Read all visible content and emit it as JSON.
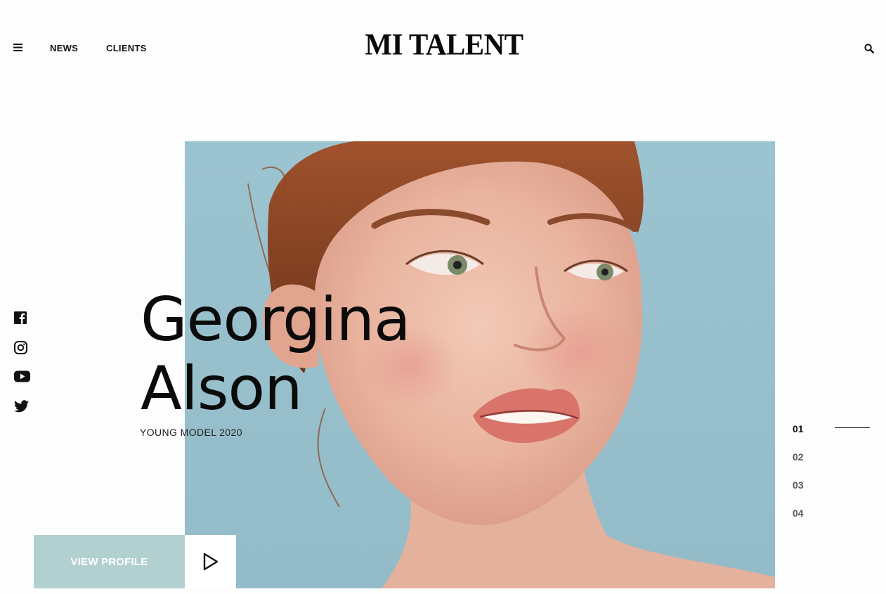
{
  "header": {
    "menu_icon": "hamburger-menu-icon",
    "nav": [
      {
        "label": "NEWS"
      },
      {
        "label": "CLIENTS"
      }
    ],
    "logo": "MI TALENT",
    "search_icon": "search-icon"
  },
  "hero": {
    "name_first": "Georgina",
    "name_last": "Alson",
    "subtitle": "YOUNG MODEL 2020",
    "image": "model-portrait-photo",
    "background_color": "#9cc4d0"
  },
  "social": [
    {
      "icon": "facebook-icon"
    },
    {
      "icon": "instagram-icon"
    },
    {
      "icon": "youtube-icon"
    },
    {
      "icon": "twitter-icon"
    }
  ],
  "slider": {
    "items": [
      "01",
      "02",
      "03",
      "04"
    ],
    "active": "01"
  },
  "cta": {
    "view_profile_label": "VIEW PROFILE",
    "view_profile_color": "#b2d0cf",
    "play_icon": "play-icon"
  }
}
